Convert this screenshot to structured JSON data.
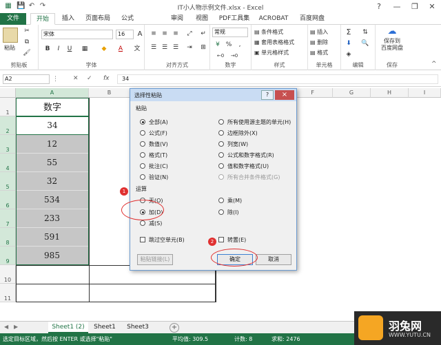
{
  "title": "IT小人物示例文件.xlsx - Excel",
  "tabs": [
    "文件",
    "开始",
    "插入",
    "页面布局",
    "公式",
    "审阅",
    "视图",
    "PDF工具集",
    "ACROBAT",
    "百度网盘"
  ],
  "ribbon": {
    "paste": "粘贴",
    "clipboard": "剪贴板",
    "font_name": "宋体",
    "font_size": "16",
    "bold": "B",
    "italic": "I",
    "underline": "U",
    "font_group": "字体",
    "align_group": "对齐方式",
    "number_format": "常规",
    "percent": "%",
    "comma": ",",
    "number_group": "数字",
    "cond_format": "条件格式",
    "table_format": "套用表格格式",
    "cell_style": "单元格样式",
    "styles_group": "样式",
    "insert": "插入",
    "delete": "删除",
    "format": "格式",
    "cells_group": "单元格",
    "edit_group": "编辑",
    "save_baidu": "保存到\n百度网盘",
    "save_group": "保存",
    "sigma": "Σ",
    "font_grow": "A",
    "font_shrink": "A",
    "font_color": "A",
    "ab": "ab"
  },
  "formula_bar": {
    "name_box": "A2",
    "value": "34",
    "fx": "fx"
  },
  "columns": [
    "A",
    "B",
    "C",
    "D",
    "E",
    "F",
    "G",
    "H",
    "I"
  ],
  "rows": [
    "1",
    "2",
    "3",
    "4",
    "5",
    "6",
    "7",
    "8",
    "9",
    "10",
    "11"
  ],
  "cells": {
    "header": "数字",
    "values": [
      "34",
      "12",
      "55",
      "32",
      "534",
      "233",
      "591",
      "985"
    ]
  },
  "dialog": {
    "title": "选择性粘贴",
    "help": "?",
    "close": "×",
    "paste_label": "粘贴",
    "paste_left": [
      "全部(A)",
      "公式(F)",
      "数值(V)",
      "格式(T)",
      "批注(C)",
      "验证(N)"
    ],
    "paste_right": [
      "所有使用源主题的单元(H)",
      "边框除外(X)",
      "列宽(W)",
      "公式和数字格式(R)",
      "值和数字格式(U)",
      "所有合并条件格式(G)"
    ],
    "op_label": "运算",
    "op_left": [
      "无(O)",
      "加(D)",
      "减(S)"
    ],
    "op_right": [
      "乘(M)",
      "除(I)"
    ],
    "skip_blanks": "跳过空单元(B)",
    "transpose": "转置(E)",
    "paste_link": "粘贴链接(L)",
    "ok": "确定",
    "cancel": "取消"
  },
  "annotations": [
    "1",
    "2"
  ],
  "sheets": [
    "Sheet1 (2)",
    "Sheet1",
    "Sheet3"
  ],
  "add_sheet": "+",
  "status": {
    "left": "选定目标区域，然后按 ENTER 或选择\"粘贴\"",
    "avg": "平均值: 309.5",
    "count": "计数: 8",
    "sum": "求和: 2476"
  },
  "logo": {
    "name": "羽兔网",
    "url": "WWW.YUTU.CN"
  },
  "colors": {
    "excel_green": "#217346",
    "annotation_red": "#e03030"
  }
}
